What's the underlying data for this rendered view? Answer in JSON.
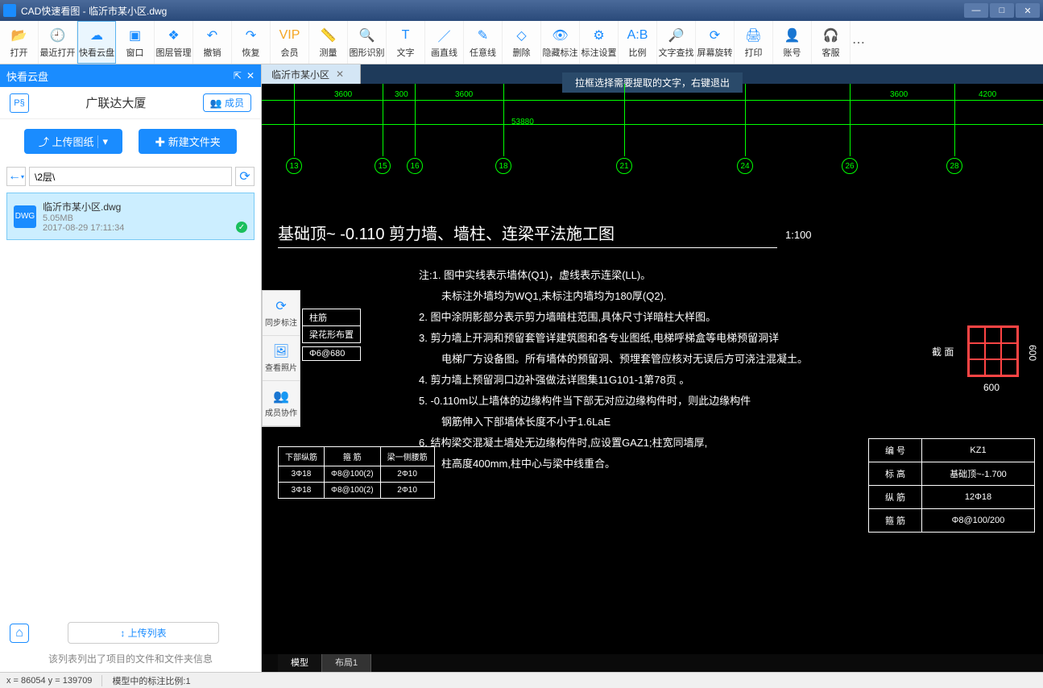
{
  "window": {
    "title": "CAD快速看图 - 临沂市某小区.dwg",
    "min": "—",
    "max": "□",
    "close": "✕"
  },
  "toolbar": [
    {
      "label": "打开",
      "icon": "📂"
    },
    {
      "label": "最近打开",
      "icon": "🕘"
    },
    {
      "label": "快看云盘",
      "icon": "☁"
    },
    {
      "label": "窗口",
      "icon": "▣"
    },
    {
      "label": "图层管理",
      "icon": "❖"
    },
    {
      "label": "撤销",
      "icon": "↶"
    },
    {
      "label": "恢复",
      "icon": "↷"
    },
    {
      "label": "会员",
      "icon": "VIP"
    },
    {
      "label": "测量",
      "icon": "📏"
    },
    {
      "label": "图形识别",
      "icon": "🔍"
    },
    {
      "label": "文字",
      "icon": "T"
    },
    {
      "label": "画直线",
      "icon": "／"
    },
    {
      "label": "任意线",
      "icon": "✎"
    },
    {
      "label": "删除",
      "icon": "◇"
    },
    {
      "label": "隐藏标注",
      "icon": "👁"
    },
    {
      "label": "标注设置",
      "icon": "⚙"
    },
    {
      "label": "比例",
      "icon": "A:B"
    },
    {
      "label": "文字查找",
      "icon": "🔎"
    },
    {
      "label": "屏幕旋转",
      "icon": "⟳"
    },
    {
      "label": "打印",
      "icon": "🖨"
    },
    {
      "label": "账号",
      "icon": "👤"
    },
    {
      "label": "客服",
      "icon": "🎧"
    }
  ],
  "panel": {
    "title": "快看云盘",
    "pin": "⇱",
    "close": "✕",
    "company": "广联达大厦",
    "members": "👥 成员",
    "upload": "⤴ 上传图纸",
    "upload_dd": "▾",
    "newfolder": "✚ 新建文件夹",
    "path": "\\2层\\",
    "back": "←",
    "refresh": "⟳"
  },
  "file": {
    "name": "临沂市某小区.dwg",
    "size": "5.05MB",
    "date": "2017-08-29 17:11:34",
    "check": "✓"
  },
  "footer": {
    "home": "⌂",
    "upload_list": "↕ 上传列表",
    "hint": "该列表列出了项目的文件和文件夹信息"
  },
  "tab": {
    "name": "临沂市某小区",
    "close": "✕"
  },
  "side_tools": [
    {
      "label": "同步标注",
      "icon": "⟳"
    },
    {
      "label": "查看照片",
      "icon": "🖼"
    },
    {
      "label": "成员协作",
      "icon": "👥"
    }
  ],
  "tooltip": "拉框选择需要提取的文字，右键退出",
  "drawing": {
    "title": "基础顶~ -0.110 剪力墙、墙柱、连梁平法施工图",
    "scale": "1:100",
    "total_dim": "53880",
    "dims": [
      "3600",
      "300",
      "3600",
      "3600",
      "4200"
    ],
    "axes": [
      "13",
      "15",
      "16",
      "18",
      "21",
      "24",
      "26",
      "28"
    ],
    "notes": [
      "注:1. 图中实线表示墙体(Q1)，虚线表示连梁(LL)。",
      "未标注外墙均为WQ1,未标注内墙均为180厚(Q2).",
      "2. 图中涂阴影部分表示剪力墙暗柱范围,具体尺寸详暗柱大样图。",
      "3. 剪力墙上开洞和预留套管详建筑图和各专业图纸,电梯呼梯盒等电梯预留洞详",
      "电梯厂方设备图。所有墙体的预留洞、预埋套管应核对无误后方可浇注混凝土。",
      "4. 剪力墙上预留洞口边补强做法详图集11G101-1第78页 。",
      "5. -0.110m以上墙体的边缘构件当下部无对应边缘构件时，则此边缘构件",
      "钢筋伸入下部墙体长度不小于1.6LaE",
      "6. 结构梁交混凝土墙处无边缘构件时,应设置GAZ1;柱宽同墙厚,",
      "柱高度400mm,柱中心与梁中线重合。"
    ]
  },
  "small_table": {
    "headers": [
      "下部纵筋",
      "箍 筋",
      "梁一侧腰筋"
    ],
    "rows": [
      [
        "3Φ18",
        "Φ8@100(2)",
        "2Φ10"
      ],
      [
        "3Φ18",
        "Φ8@100(2)",
        "2Φ10"
      ]
    ]
  },
  "partial": {
    "r1": "柱筋",
    "r2": "梁花形布置",
    "r3": "Φ6@680"
  },
  "section": {
    "label": "截 面",
    "w": "600",
    "h": "600"
  },
  "right_table": {
    "rows": [
      [
        "编 号",
        "KZ1"
      ],
      [
        "标 高",
        "基础顶~-1.700"
      ],
      [
        "纵 筋",
        "12Φ18"
      ],
      [
        "箍 筋",
        "Φ8@100/200"
      ]
    ]
  },
  "bottom_tabs": {
    "model": "模型",
    "layout": "布局1"
  },
  "status": {
    "coords": "x = 86054  y = 139709",
    "scale": "模型中的标注比例:1"
  }
}
